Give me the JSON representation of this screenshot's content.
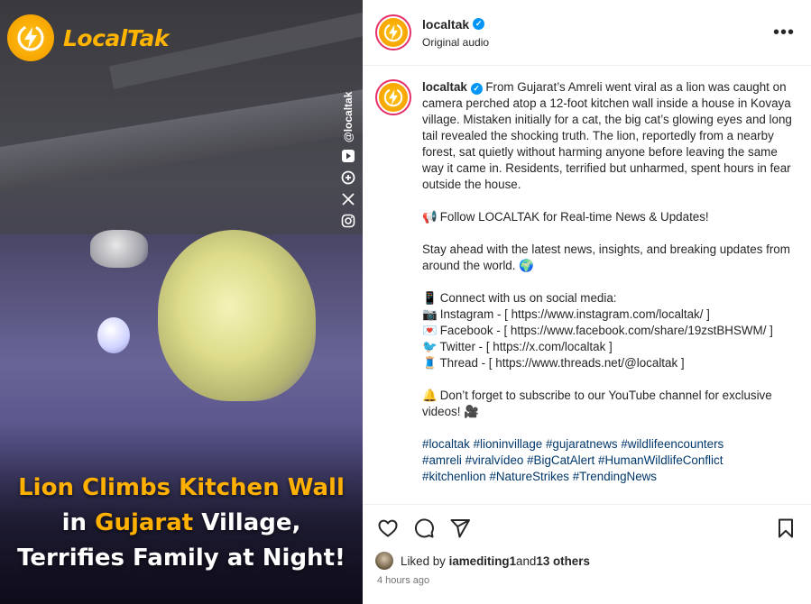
{
  "media": {
    "brand_name": "LocalTak",
    "social_handle": "@localtak",
    "social_icons": [
      "youtube-icon",
      "threads-icon",
      "x-icon",
      "instagram-icon"
    ],
    "headline": {
      "line1": "Lion Climbs Kitchen Wall",
      "line2_prefix": "in ",
      "line2_highlight": "Gujarat",
      "line2_suffix": " Village,",
      "line3": "Terrifies Family at Night!"
    }
  },
  "header": {
    "username": "localtak",
    "audio": "Original audio",
    "more": "•••"
  },
  "caption": {
    "username": "localtak",
    "intro": "From Gujarat’s Amreli went viral as a lion was caught on camera perched atop a 12-foot kitchen wall inside a house in Kovaya village. Mistaken initially for a cat, the big cat’s glowing eyes and long tail revealed the shocking truth. The lion, reportedly from a nearby forest, sat quietly without harming anyone before leaving the same way it came in. Residents, terrified but unharmed, spent hours in fear outside the house.",
    "follow": "Follow LOCALTAK for Real-time News & Updates!",
    "stay": "Stay ahead with the latest news, insights, and breaking updates from around the world.",
    "connect": "Connect with us on social media:",
    "instagram": "Instagram - [ https://www.instagram.com/localtak/ ]",
    "facebook": "Facebook - [ https://www.facebook.com/share/19zstBHSWM/ ]",
    "twitter": "Twitter - [ https://x.com/localtak ]",
    "thread": "Thread - [ https://www.threads.net/@localtak ]",
    "youtube": "Don’t forget to subscribe to our YouTube channel for exclusive videos!",
    "hashtags_line1": "#localtak #lioninvillage #gujaratnews #wildlifeencounters",
    "hashtags_line2": "#amreli #viralvídeo #BigCatAlert #HumanWildlifeConflict",
    "hashtags_line3": "#kitchenlion #NatureStrikes #TrendingNews"
  },
  "likes": {
    "prefix": "Liked by ",
    "user": "iamediting1",
    "middle": " and ",
    "others": "13 others"
  },
  "timestamp": "4 hours ago",
  "colors": {
    "brand_orange": "#ffb000",
    "verified_blue": "#0095f6",
    "hashtag_blue": "#00376b"
  }
}
